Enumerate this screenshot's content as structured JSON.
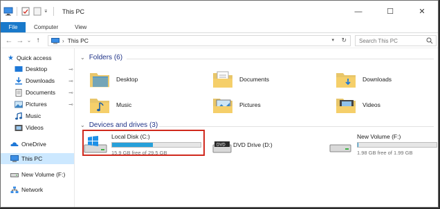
{
  "window": {
    "title": "This PC",
    "controls": {
      "minimize": "—",
      "maximize": "☐",
      "close": "✕"
    },
    "quick_access_toolbar": [
      "computer-icon",
      "properties-check-icon",
      "new-folder-icon",
      "customize-dropdown-icon"
    ]
  },
  "ribbon": {
    "tabs": [
      "File",
      "Computer",
      "View"
    ],
    "active_tab": "File",
    "accent_color": "#1979ca"
  },
  "navbar": {
    "back": "←",
    "forward": "→",
    "recent": "⌄",
    "up": "↑",
    "address_separator": "›",
    "address": "This PC",
    "search_placeholder": "Search This PC"
  },
  "sidebar": {
    "items": [
      {
        "label": "Quick access",
        "icon": "star-icon",
        "pinned": false
      },
      {
        "label": "Desktop",
        "icon": "desktop-folder-icon",
        "pinned": true
      },
      {
        "label": "Downloads",
        "icon": "downloads-icon",
        "pinned": true
      },
      {
        "label": "Documents",
        "icon": "documents-icon",
        "pinned": true
      },
      {
        "label": "Pictures",
        "icon": "pictures-icon",
        "pinned": true
      },
      {
        "label": "Music",
        "icon": "music-icon",
        "pinned": false
      },
      {
        "label": "Videos",
        "icon": "videos-icon",
        "pinned": false
      },
      {
        "label": "OneDrive",
        "icon": "onedrive-cloud-icon",
        "pinned": false
      },
      {
        "label": "This PC",
        "icon": "computer-icon",
        "pinned": false,
        "selected": true
      },
      {
        "label": "New Volume (F:)",
        "icon": "drive-icon",
        "pinned": false
      },
      {
        "label": "Network",
        "icon": "network-icon",
        "pinned": false
      }
    ],
    "pin_glyph": "📌"
  },
  "main": {
    "folders_header": "Folders (6)",
    "folders": [
      {
        "label": "Desktop",
        "icon": "desktop-folder-icon"
      },
      {
        "label": "Documents",
        "icon": "documents-folder-icon"
      },
      {
        "label": "Downloads",
        "icon": "downloads-folder-icon"
      },
      {
        "label": "Music",
        "icon": "music-folder-icon"
      },
      {
        "label": "Pictures",
        "icon": "pictures-folder-icon"
      },
      {
        "label": "Videos",
        "icon": "videos-folder-icon"
      }
    ],
    "drives_header": "Devices and drives (3)",
    "drives": [
      {
        "label": "Local Disk (C:)",
        "free": "15.9 GB free of 29.5 GB",
        "used_fraction": 0.46,
        "icon": "windows-drive-icon",
        "highlighted": true
      },
      {
        "label": "DVD Drive (D:)",
        "icon": "dvd-drive-icon"
      },
      {
        "label": "New Volume (F:)",
        "free": "1.98 GB free of 1.99 GB",
        "used_fraction": 0.01,
        "icon": "drive-icon"
      }
    ],
    "highlight_color": "#d0281c",
    "bar_color": "#26a0da"
  }
}
